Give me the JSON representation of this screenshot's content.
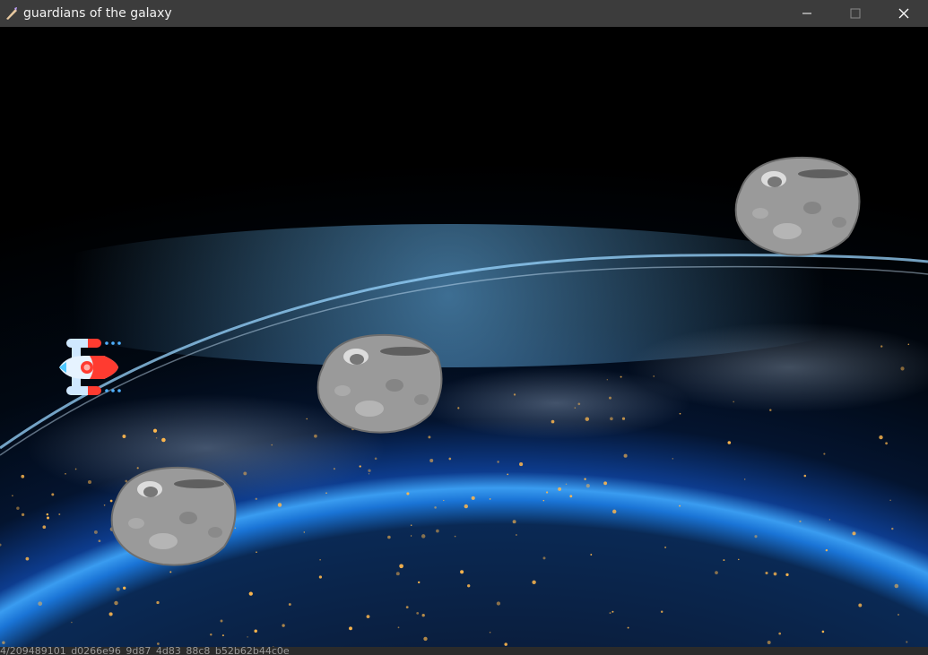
{
  "window": {
    "title": "guardians of the galaxy",
    "controls": [
      "minimize-icon",
      "maximize-icon",
      "close-icon"
    ]
  },
  "game": {
    "player": {
      "icon": "spaceship-icon"
    },
    "asteroids": [
      {
        "icon": "asteroid-icon"
      },
      {
        "icon": "asteroid-icon"
      },
      {
        "icon": "asteroid-icon"
      }
    ],
    "background": "earth-from-space",
    "colors": {
      "atmosphere": "#3a9cf0",
      "city_lights": "#ffb84d",
      "ship_body": "#cfe8ff",
      "ship_accent": "#ff3b30"
    }
  },
  "statusbar": {
    "text": "4/209489101_d0266e96_9d87_4d83_88c8_b52b62b44c0e"
  }
}
